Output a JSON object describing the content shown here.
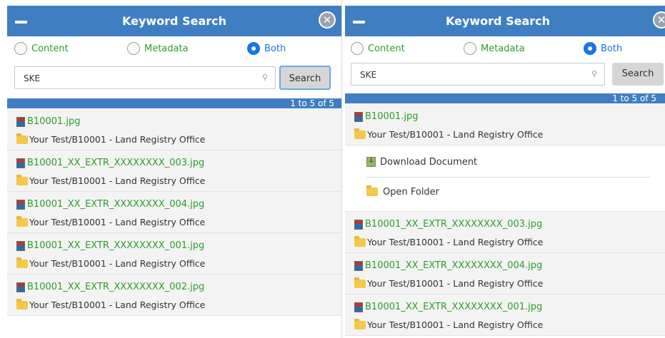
{
  "dialog": {
    "title": "Keyword Search",
    "close_icon": "close-circle-icon",
    "minimize_icon": "minimize-icon"
  },
  "radios": [
    {
      "label": "Content",
      "checked": false
    },
    {
      "label": "Metadata",
      "checked": false
    },
    {
      "label": "Both",
      "checked": true
    }
  ],
  "search": {
    "value": "SKE",
    "button_label": "Search"
  },
  "results": {
    "count_text": "1 to 5 of 5",
    "items": [
      {
        "file": "B10001.jpg",
        "folder": "Your Test/B10001 - Land Registry Office"
      },
      {
        "file": "B10001_XX_EXTR_XXXXXXXX_003.jpg",
        "folder": "Your Test/B10001 - Land Registry Office"
      },
      {
        "file": "B10001_XX_EXTR_XXXXXXXX_004.jpg",
        "folder": "Your Test/B10001 - Land Registry Office"
      },
      {
        "file": "B10001_XX_EXTR_XXXXXXXX_001.jpg",
        "folder": "Your Test/B10001 - Land Registry Office"
      },
      {
        "file": "B10001_XX_EXTR_XXXXXXXX_002.jpg",
        "folder": "Your Test/B10001 - Land Registry Office"
      }
    ]
  },
  "context_menu": {
    "download": "Download Document",
    "open_folder": "Open Folder"
  },
  "colors": {
    "accent_blue": "#3f7fc1",
    "file_green": "#2a9e2a",
    "radio_checked": "#1a73e8"
  }
}
